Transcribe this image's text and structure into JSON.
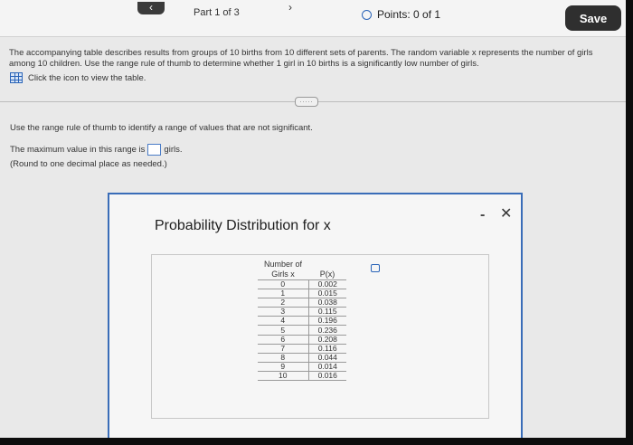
{
  "topbar": {
    "prev_glyph": "‹",
    "part_label": "Part 1 of 3",
    "next_glyph": "›",
    "points_label": "Points: 0 of 1",
    "save_label": "Save"
  },
  "question": {
    "text": "The accompanying table describes results from groups of 10 births from 10 different sets of parents. The random variable x represents the number of girls among 10 children. Use the range rule of thumb to determine whether 1 girl in 10 births is a significantly low number of girls.",
    "table_link_label": "Click the icon to view the table.",
    "divider_handle": "....."
  },
  "answer": {
    "instruction": "Use the range rule of thumb to identify a range of values that are not significant.",
    "prefix": "The maximum value in this range is",
    "suffix": "girls.",
    "round_note": "(Round to one decimal place as needed.)"
  },
  "popup": {
    "title": "Probability Distribution for x",
    "minimize_glyph": "-",
    "close_glyph": "✕",
    "table": {
      "header_x_line1": "Number of",
      "header_x_line2": "Girls x",
      "header_p": "P(x)",
      "rows": [
        {
          "x": "0",
          "p": "0.002"
        },
        {
          "x": "1",
          "p": "0.015"
        },
        {
          "x": "2",
          "p": "0.038"
        },
        {
          "x": "3",
          "p": "0.115"
        },
        {
          "x": "4",
          "p": "0.196"
        },
        {
          "x": "5",
          "p": "0.236"
        },
        {
          "x": "6",
          "p": "0.208"
        },
        {
          "x": "7",
          "p": "0.116"
        },
        {
          "x": "8",
          "p": "0.044"
        },
        {
          "x": "9",
          "p": "0.014"
        },
        {
          "x": "10",
          "p": "0.016"
        }
      ]
    }
  }
}
